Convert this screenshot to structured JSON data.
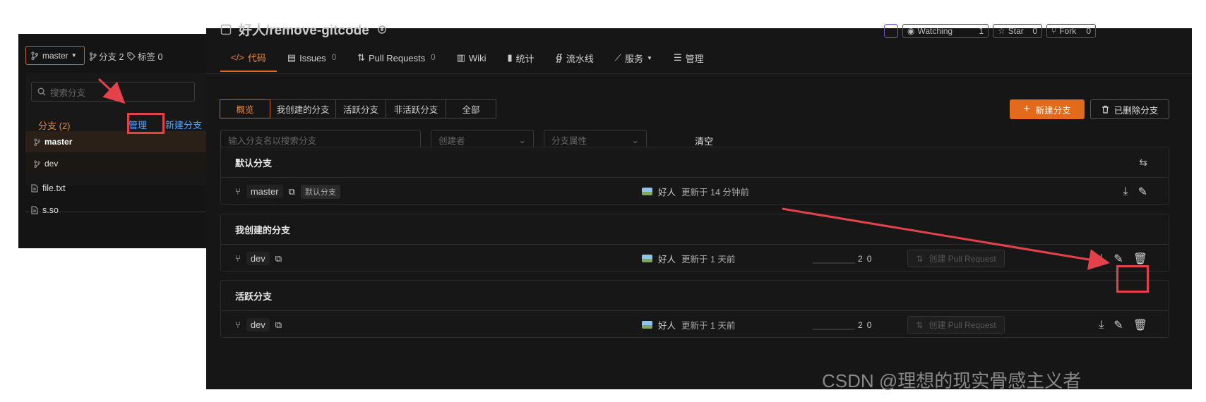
{
  "left_panel": {
    "branch_selector": "master",
    "branches_link": "分支 2",
    "tags_link": "标签 0",
    "search_placeholder": "搜索分支",
    "tab_label": "分支 (2)",
    "manage_label": "管理",
    "new_branch_label": "新建分支",
    "branches": [
      "master",
      "dev"
    ],
    "files": [
      "file.txt",
      "s.so"
    ]
  },
  "repo": {
    "title": "好人/remove-gitcode",
    "watching_label": "Watching",
    "watching_count": "1",
    "star_label": "Star",
    "star_count": "0",
    "fork_label": "Fork",
    "fork_count": "0"
  },
  "nav": {
    "code": "代码",
    "issues": "Issues",
    "issues_count": "0",
    "pull_requests": "Pull Requests",
    "pull_requests_count": "0",
    "wiki": "Wiki",
    "stats": "统计",
    "pipeline": "流水线",
    "services": "服务",
    "manage": "管理"
  },
  "branch_tabs": [
    "概览",
    "我创建的分支",
    "活跃分支",
    "非活跃分支",
    "全部"
  ],
  "actions": {
    "new_branch": "新建分支",
    "deleted_branches": "已删除分支"
  },
  "filters": {
    "search_placeholder": "输入分支名以搜索分支",
    "creator_placeholder": "创建者",
    "attribute_placeholder": "分支属性",
    "clear": "清空"
  },
  "sections": {
    "default": {
      "title": "默认分支",
      "branch": "master",
      "badge": "默认分支",
      "author": "好人",
      "updated": "更新于 14 分钟前"
    },
    "mine": {
      "title": "我创建的分支",
      "branch": "dev",
      "author": "好人",
      "updated": "更新于 1 天前",
      "behind": "2",
      "ahead": "0",
      "pr_label": "创建 Pull Request"
    },
    "active": {
      "title": "活跃分支",
      "branch": "dev",
      "author": "好人",
      "updated": "更新于 1 天前",
      "behind": "2",
      "ahead": "0",
      "pr_label": "创建 Pull Request"
    }
  },
  "watermark": "CSDN @理想的现实骨感主义者",
  "colors": {
    "accent": "#e26a1a",
    "annotation": "#e4414b",
    "link": "#4aa3ff",
    "background": "#161616"
  }
}
